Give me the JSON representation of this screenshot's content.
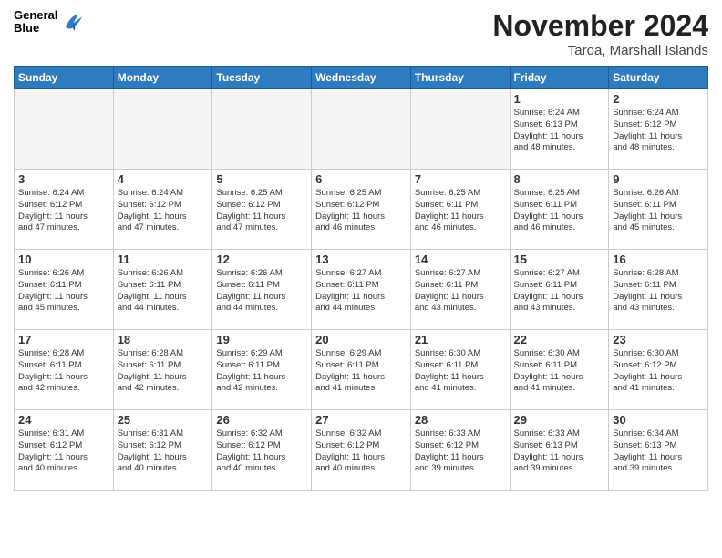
{
  "header": {
    "logo": {
      "general": "General",
      "blue": "Blue"
    },
    "title": "November 2024",
    "location": "Taroa, Marshall Islands"
  },
  "weekdays": [
    "Sunday",
    "Monday",
    "Tuesday",
    "Wednesday",
    "Thursday",
    "Friday",
    "Saturday"
  ],
  "weeks": [
    [
      {
        "day": "",
        "info": ""
      },
      {
        "day": "",
        "info": ""
      },
      {
        "day": "",
        "info": ""
      },
      {
        "day": "",
        "info": ""
      },
      {
        "day": "",
        "info": ""
      },
      {
        "day": "1",
        "info": "Sunrise: 6:24 AM\nSunset: 6:13 PM\nDaylight: 11 hours\nand 48 minutes."
      },
      {
        "day": "2",
        "info": "Sunrise: 6:24 AM\nSunset: 6:12 PM\nDaylight: 11 hours\nand 48 minutes."
      }
    ],
    [
      {
        "day": "3",
        "info": "Sunrise: 6:24 AM\nSunset: 6:12 PM\nDaylight: 11 hours\nand 47 minutes."
      },
      {
        "day": "4",
        "info": "Sunrise: 6:24 AM\nSunset: 6:12 PM\nDaylight: 11 hours\nand 47 minutes."
      },
      {
        "day": "5",
        "info": "Sunrise: 6:25 AM\nSunset: 6:12 PM\nDaylight: 11 hours\nand 47 minutes."
      },
      {
        "day": "6",
        "info": "Sunrise: 6:25 AM\nSunset: 6:12 PM\nDaylight: 11 hours\nand 46 minutes."
      },
      {
        "day": "7",
        "info": "Sunrise: 6:25 AM\nSunset: 6:11 PM\nDaylight: 11 hours\nand 46 minutes."
      },
      {
        "day": "8",
        "info": "Sunrise: 6:25 AM\nSunset: 6:11 PM\nDaylight: 11 hours\nand 46 minutes."
      },
      {
        "day": "9",
        "info": "Sunrise: 6:26 AM\nSunset: 6:11 PM\nDaylight: 11 hours\nand 45 minutes."
      }
    ],
    [
      {
        "day": "10",
        "info": "Sunrise: 6:26 AM\nSunset: 6:11 PM\nDaylight: 11 hours\nand 45 minutes."
      },
      {
        "day": "11",
        "info": "Sunrise: 6:26 AM\nSunset: 6:11 PM\nDaylight: 11 hours\nand 44 minutes."
      },
      {
        "day": "12",
        "info": "Sunrise: 6:26 AM\nSunset: 6:11 PM\nDaylight: 11 hours\nand 44 minutes."
      },
      {
        "day": "13",
        "info": "Sunrise: 6:27 AM\nSunset: 6:11 PM\nDaylight: 11 hours\nand 44 minutes."
      },
      {
        "day": "14",
        "info": "Sunrise: 6:27 AM\nSunset: 6:11 PM\nDaylight: 11 hours\nand 43 minutes."
      },
      {
        "day": "15",
        "info": "Sunrise: 6:27 AM\nSunset: 6:11 PM\nDaylight: 11 hours\nand 43 minutes."
      },
      {
        "day": "16",
        "info": "Sunrise: 6:28 AM\nSunset: 6:11 PM\nDaylight: 11 hours\nand 43 minutes."
      }
    ],
    [
      {
        "day": "17",
        "info": "Sunrise: 6:28 AM\nSunset: 6:11 PM\nDaylight: 11 hours\nand 42 minutes."
      },
      {
        "day": "18",
        "info": "Sunrise: 6:28 AM\nSunset: 6:11 PM\nDaylight: 11 hours\nand 42 minutes."
      },
      {
        "day": "19",
        "info": "Sunrise: 6:29 AM\nSunset: 6:11 PM\nDaylight: 11 hours\nand 42 minutes."
      },
      {
        "day": "20",
        "info": "Sunrise: 6:29 AM\nSunset: 6:11 PM\nDaylight: 11 hours\nand 41 minutes."
      },
      {
        "day": "21",
        "info": "Sunrise: 6:30 AM\nSunset: 6:11 PM\nDaylight: 11 hours\nand 41 minutes."
      },
      {
        "day": "22",
        "info": "Sunrise: 6:30 AM\nSunset: 6:11 PM\nDaylight: 11 hours\nand 41 minutes."
      },
      {
        "day": "23",
        "info": "Sunrise: 6:30 AM\nSunset: 6:12 PM\nDaylight: 11 hours\nand 41 minutes."
      }
    ],
    [
      {
        "day": "24",
        "info": "Sunrise: 6:31 AM\nSunset: 6:12 PM\nDaylight: 11 hours\nand 40 minutes."
      },
      {
        "day": "25",
        "info": "Sunrise: 6:31 AM\nSunset: 6:12 PM\nDaylight: 11 hours\nand 40 minutes."
      },
      {
        "day": "26",
        "info": "Sunrise: 6:32 AM\nSunset: 6:12 PM\nDaylight: 11 hours\nand 40 minutes."
      },
      {
        "day": "27",
        "info": "Sunrise: 6:32 AM\nSunset: 6:12 PM\nDaylight: 11 hours\nand 40 minutes."
      },
      {
        "day": "28",
        "info": "Sunrise: 6:33 AM\nSunset: 6:12 PM\nDaylight: 11 hours\nand 39 minutes."
      },
      {
        "day": "29",
        "info": "Sunrise: 6:33 AM\nSunset: 6:13 PM\nDaylight: 11 hours\nand 39 minutes."
      },
      {
        "day": "30",
        "info": "Sunrise: 6:34 AM\nSunset: 6:13 PM\nDaylight: 11 hours\nand 39 minutes."
      }
    ]
  ]
}
